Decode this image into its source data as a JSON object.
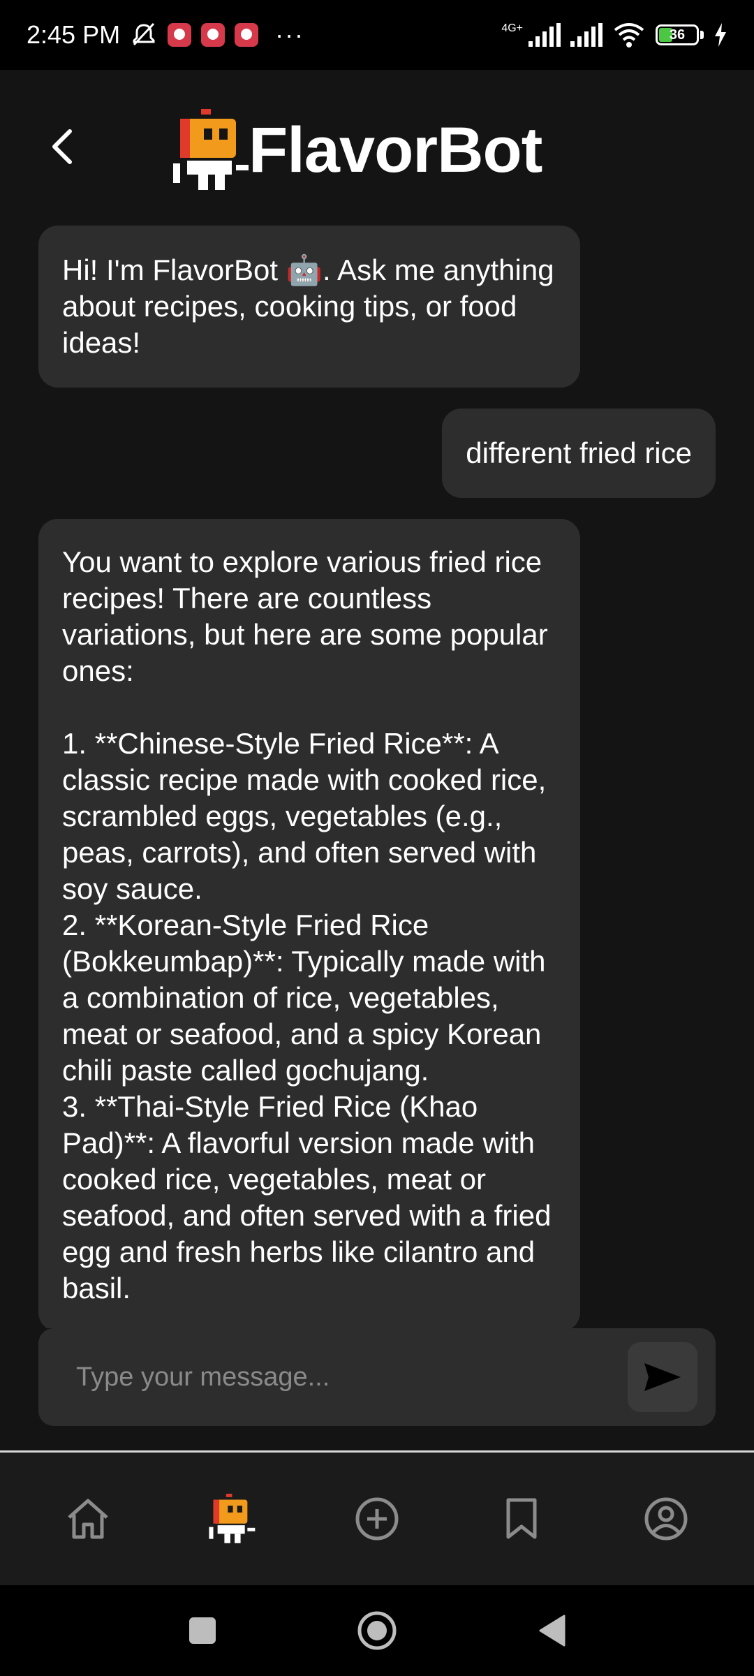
{
  "status_bar": {
    "time": "2:45 PM",
    "network_label": "4G+",
    "battery_level": "36",
    "battery_percent": 36,
    "more_indicator": "···"
  },
  "header": {
    "app_name": "FlavorBot",
    "logo_icon": "robot-logo-icon",
    "back_icon": "chevron-left-icon"
  },
  "chat": {
    "messages": [
      {
        "role": "bot",
        "text": "Hi! I'm FlavorBot 🤖. Ask me anything about recipes, cooking tips, or food ideas!"
      },
      {
        "role": "user",
        "text": "different fried rice"
      },
      {
        "role": "bot",
        "text": "You want to explore various fried rice recipes! There are countless variations, but here are some popular ones:\n\n1. **Chinese-Style Fried Rice**: A classic recipe made with cooked rice, scrambled eggs, vegetables (e.g., peas, carrots), and often served with soy sauce.\n2. **Korean-Style Fried Rice (Bokkeumbap)**: Typically made with a combination of rice, vegetables, meat or seafood, and a spicy Korean chili paste called gochujang.\n3. **Thai-Style Fried Rice (Khao Pad)**: A flavorful version made with cooked rice, vegetables, meat or seafood, and often served with a fried egg and fresh herbs like cilantro and basil."
      }
    ]
  },
  "composer": {
    "placeholder": "Type your message...",
    "value": "",
    "send_icon": "send-icon"
  },
  "bottom_nav": {
    "items": [
      {
        "icon": "home-icon",
        "active": false
      },
      {
        "icon": "robot-icon",
        "active": true
      },
      {
        "icon": "add-circle-icon",
        "active": false
      },
      {
        "icon": "bookmark-icon",
        "active": false
      },
      {
        "icon": "profile-icon",
        "active": false
      }
    ]
  },
  "colors": {
    "background": "#141414",
    "bubble": "#2d2d2d",
    "logo_orange": "#f29a1b",
    "logo_red": "#e03a2a",
    "text": "#ffffff",
    "placeholder": "#8a8a8a"
  }
}
